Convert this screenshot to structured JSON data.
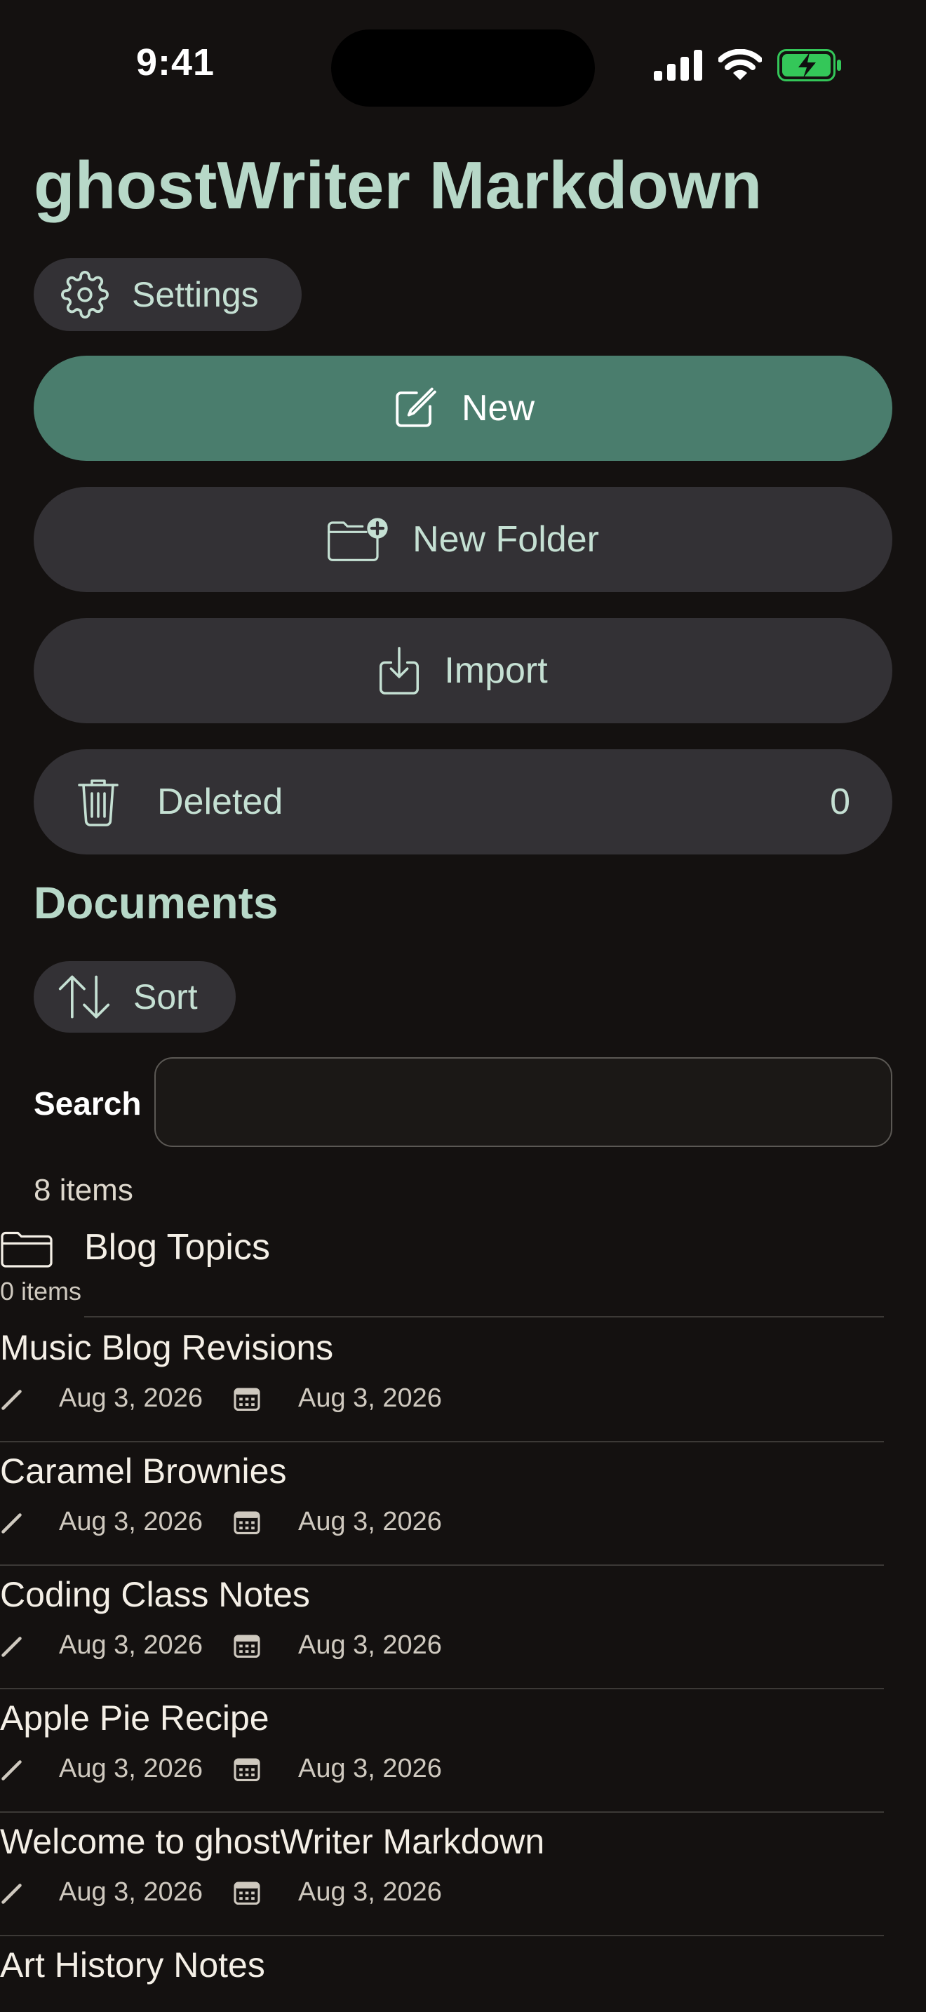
{
  "status_bar": {
    "time": "9:41"
  },
  "app": {
    "title": "ghostWriter Markdown"
  },
  "buttons": {
    "settings": "Settings",
    "new": "New",
    "new_folder": "New Folder",
    "import": "Import",
    "deleted": "Deleted",
    "deleted_count": "0",
    "sort": "Sort"
  },
  "documents_section": {
    "title": "Documents",
    "search_label": "Search",
    "search_value": "",
    "item_count": "8 items"
  },
  "folders": [
    {
      "name": "Blog Topics",
      "count": "0 items"
    }
  ],
  "documents": [
    {
      "name": "Music Blog Revisions",
      "modified": "Aug 3, 2026",
      "created": "Aug 3, 2026"
    },
    {
      "name": "Caramel Brownies",
      "modified": "Aug 3, 2026",
      "created": "Aug 3, 2026"
    },
    {
      "name": "Coding Class Notes",
      "modified": "Aug 3, 2026",
      "created": "Aug 3, 2026"
    },
    {
      "name": "Apple Pie Recipe",
      "modified": "Aug 3, 2026",
      "created": "Aug 3, 2026"
    },
    {
      "name": "Welcome to ghostWriter Markdown",
      "modified": "Aug 3, 2026",
      "created": "Aug 3, 2026"
    },
    {
      "name": "Art History Notes"
    }
  ],
  "colors": {
    "background": "#141110",
    "accent": "#4a7d6d",
    "title": "#b7d8c8",
    "button_bg": "#333135",
    "battery": "#34c759"
  },
  "icons": {
    "settings": "gear-icon",
    "new": "compose-icon",
    "new_folder": "folder-plus-icon",
    "import": "import-icon",
    "deleted": "trash-icon",
    "sort": "sort-arrows-icon",
    "folder": "folder-icon",
    "modified": "pencil-icon",
    "created": "calendar-icon"
  }
}
